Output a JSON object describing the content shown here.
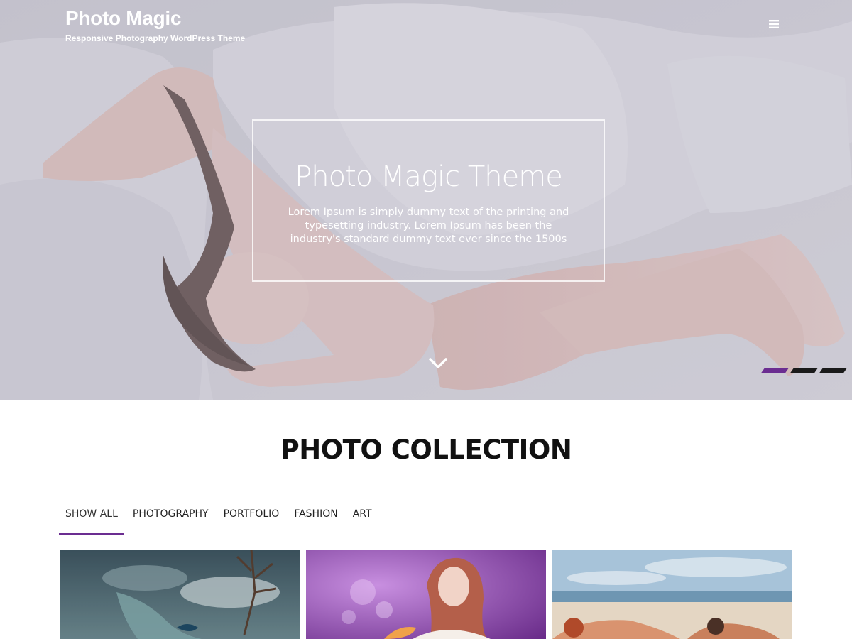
{
  "site": {
    "title": "Photo Magic",
    "tagline": "Responsive Photography WordPress Theme"
  },
  "header": {
    "menu_icon": "hamburger-menu-icon"
  },
  "hero": {
    "slide": {
      "title": "Photo Magic Theme",
      "text": "Lorem Ipsum is simply dummy text of the printing and typesetting industry. Lorem Ipsum has been the industry's standard dummy text ever since the 1500s"
    },
    "scroll_icon": "chevron-down-icon",
    "slider": {
      "count": 3,
      "active_index": 0
    }
  },
  "collection": {
    "title": "PHOTO COLLECTION",
    "tabs": [
      {
        "label": "SHOW ALL",
        "active": true
      },
      {
        "label": "PHOTOGRAPHY",
        "active": false
      },
      {
        "label": "PORTFOLIO",
        "active": false
      },
      {
        "label": "FASHION",
        "active": false
      },
      {
        "label": "ART",
        "active": false
      }
    ]
  },
  "colors": {
    "accent": "#6b2d91",
    "text_dark": "#111111",
    "white": "#ffffff"
  }
}
